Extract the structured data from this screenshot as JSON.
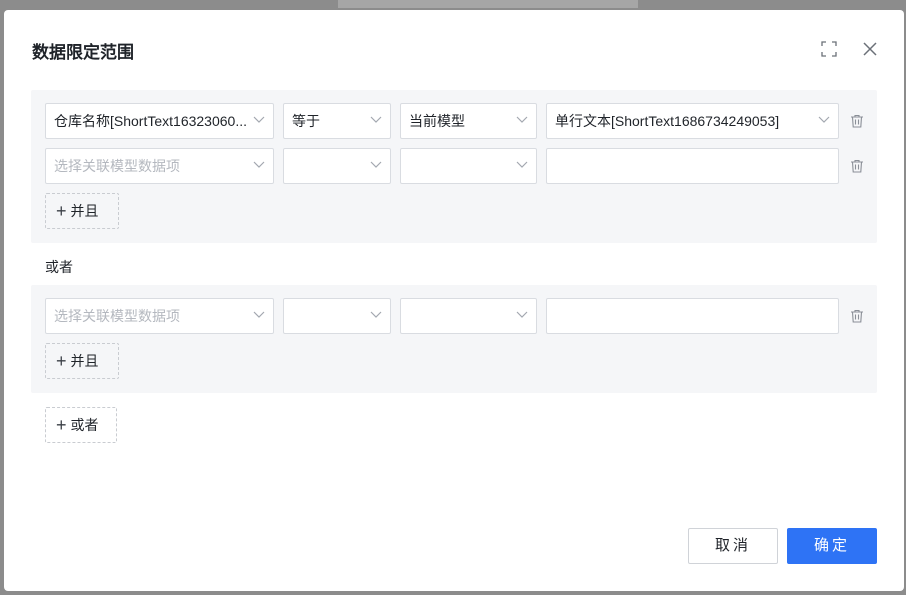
{
  "dialog": {
    "title": "数据限定范围",
    "expand_icon": "expand-icon",
    "close_icon": "close-icon"
  },
  "groups": [
    {
      "rows": [
        {
          "field": "仓库名称[ShortText16323060...",
          "field_placeholder": false,
          "operator": "等于",
          "value_type": "当前模型",
          "value": "单行文本[ShortText1686734249053]"
        },
        {
          "field": "选择关联模型数据项",
          "field_placeholder": true,
          "operator": "",
          "value_type": "",
          "value": ""
        }
      ],
      "and_label": "并且"
    },
    {
      "rows": [
        {
          "field": "选择关联模型数据项",
          "field_placeholder": true,
          "operator": "",
          "value_type": "",
          "value": ""
        }
      ],
      "and_label": "并且"
    }
  ],
  "or_label": "或者",
  "add_or_label": "或者",
  "footer": {
    "cancel_label": "取消",
    "ok_label": "确定"
  },
  "colors": {
    "primary": "#2e73f5",
    "group_bg": "#f5f6f8"
  }
}
